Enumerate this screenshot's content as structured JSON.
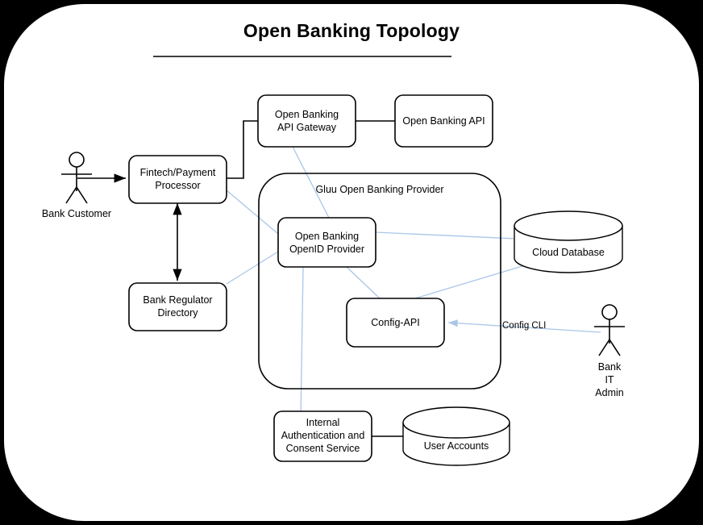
{
  "title": "Open Banking Topology",
  "colors": {
    "background": "#000000",
    "paper": "#ffffff",
    "stroke": "#000000",
    "connector_blue": "#a9c6e8"
  },
  "container": {
    "label": "Gluu Open Banking Provider"
  },
  "actors": [
    {
      "id": "bank-customer",
      "label": "Bank Customer"
    },
    {
      "id": "bank-it-admin",
      "label": "Bank\nIT\nAdmin"
    }
  ],
  "nodes": [
    {
      "id": "open-banking-api-gateway",
      "label": "Open Banking\nAPI Gateway",
      "shape": "rounded-rect"
    },
    {
      "id": "open-banking-api",
      "label": "Open Banking API",
      "shape": "rounded-rect"
    },
    {
      "id": "fintech-payment-processor",
      "label": "Fintech/Payment\nProcessor",
      "shape": "rounded-rect"
    },
    {
      "id": "bank-regulator-directory",
      "label": "Bank Regulator\nDirectory",
      "shape": "rounded-rect"
    },
    {
      "id": "open-banking-openid-provider",
      "label": "Open Banking\nOpenID Provider",
      "shape": "rounded-rect"
    },
    {
      "id": "config-api",
      "label": "Config-API",
      "shape": "rounded-rect"
    },
    {
      "id": "internal-auth-consent-service",
      "label": "Internal\nAuthentication and\nConsent Service",
      "shape": "rounded-rect"
    },
    {
      "id": "cloud-database",
      "label": "Cloud Database",
      "shape": "cylinder"
    },
    {
      "id": "user-accounts",
      "label": "User Accounts",
      "shape": "cylinder"
    }
  ],
  "edge_labels": [
    {
      "id": "config-cli",
      "label": "Config CLI"
    }
  ]
}
